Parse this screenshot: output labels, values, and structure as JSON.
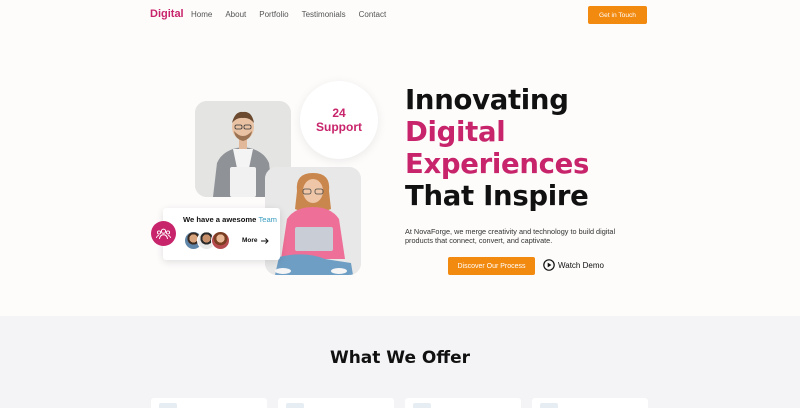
{
  "nav": {
    "brand": "Digital",
    "links": [
      "Home",
      "About",
      "Portfolio",
      "Testimonials",
      "Contact"
    ],
    "cta": "Get in Touch"
  },
  "hero": {
    "support_number": "24",
    "support_label": "Support",
    "team_card": {
      "title": "We have a awesome",
      "title_accent": "Team",
      "more": "More"
    },
    "headline": {
      "line1": "Innovating",
      "line2": "Digital",
      "line3": "Experiences",
      "line4": "That Inspire"
    },
    "subtext": "At NovaForge, we merge creativity and technology to build digital products that connect, convert, and captivate.",
    "primary_button": "Discover Our Process",
    "secondary_button": "Watch Demo"
  },
  "offer": {
    "title": "What We Offer"
  },
  "colors": {
    "brand_pink": "#c8246b",
    "accent_orange": "#f28a10",
    "team_accent": "#3a9fc1"
  }
}
